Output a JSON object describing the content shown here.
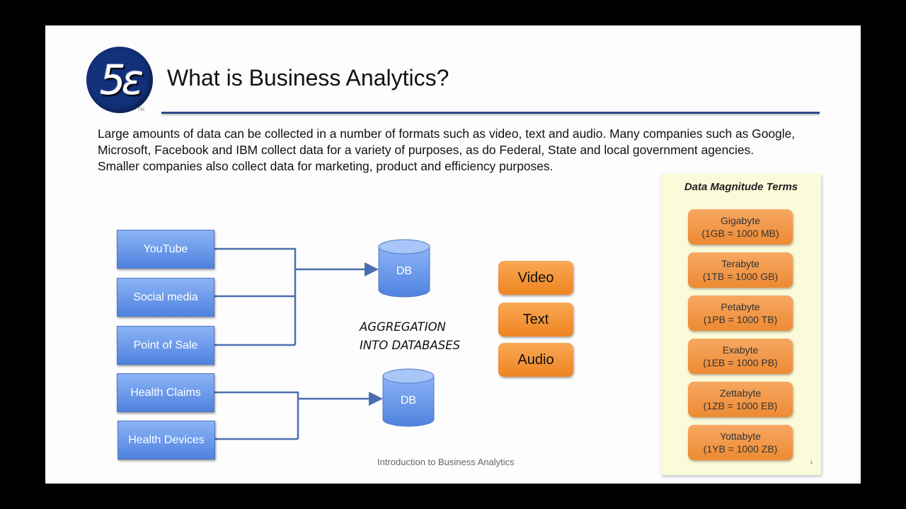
{
  "slide": {
    "title": "What is Business Analytics?",
    "logo": {
      "text": "5ε",
      "tm": "TM",
      "color": "#13307a"
    },
    "body": [
      "Large amounts of data can be collected in a number of formats such as video, text and audio. Many companies such as Google, Microsoft, Facebook and IBM collect data for a variety of purposes, as do Federal, State and local government agencies.",
      "Smaller companies also collect data for marketing, product and efficiency purposes."
    ],
    "footer": "Introduction to Business Analytics"
  },
  "diagram": {
    "sources": [
      "YouTube",
      "Social media",
      "Point of Sale",
      "Health Claims",
      "Health Devices"
    ],
    "databases": [
      "DB",
      "DB"
    ],
    "groups": [
      {
        "sources": [
          "YouTube",
          "Social media",
          "Point of Sale"
        ],
        "target": "DB"
      },
      {
        "sources": [
          "Health Claims",
          "Health Devices"
        ],
        "target": "DB"
      }
    ],
    "aggregation_label": [
      "AGGREGATION",
      "INTO DATABASES"
    ],
    "formats": [
      "Video",
      "Text",
      "Audio"
    ],
    "colors": {
      "source_box": "#5b8ee6",
      "connector": "#4a6fae",
      "format_box": "#f39235"
    }
  },
  "magnitude": {
    "title": "Data Magnitude Terms",
    "items": [
      {
        "name": "Gigabyte",
        "def": "(1GB = 1000 MB)"
      },
      {
        "name": "Terabyte",
        "def": "(1TB = 1000 GB)"
      },
      {
        "name": "Petabyte",
        "def": "(1PB = 1000 TB)"
      },
      {
        "name": "Exabyte",
        "def": "(1EB = 1000 PB)"
      },
      {
        "name": "Zettabyte",
        "def": "(1ZB = 1000 EB)"
      },
      {
        "name": "Yottabyte",
        "def": "(1YB = 1000 ZB)"
      }
    ],
    "page": "1"
  }
}
